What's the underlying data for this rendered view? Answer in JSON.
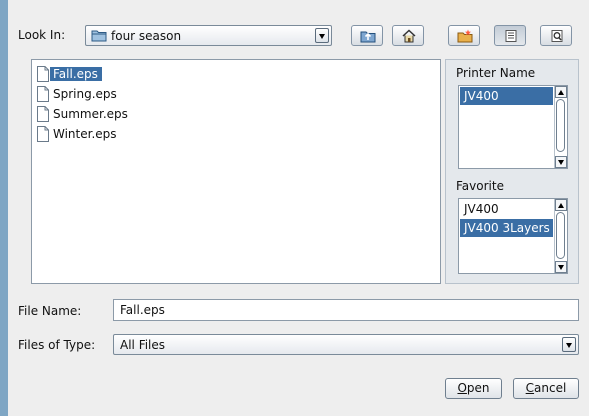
{
  "look_in": {
    "label": "Look In:",
    "value": "four season"
  },
  "toolbar": {
    "up_icon": "folder-up-icon",
    "home_icon": "home-icon",
    "new_folder_icon": "new-folder-icon",
    "list_view_icon": "list-view-icon",
    "details_view_icon": "details-view-icon"
  },
  "files": [
    {
      "name": "Fall.eps"
    },
    {
      "name": "Spring.eps"
    },
    {
      "name": "Summer.eps"
    },
    {
      "name": "Winter.eps"
    }
  ],
  "printer": {
    "label": "Printer Name",
    "items": [
      "JV400"
    ]
  },
  "favorite": {
    "label": "Favorite",
    "items": [
      "JV400",
      "JV400 3Layers"
    ]
  },
  "file_name": {
    "label": "File Name:",
    "value": "Fall.eps"
  },
  "files_of_type": {
    "label": "Files of Type:",
    "value": "All Files"
  },
  "buttons": {
    "open_mnemonic": "O",
    "open_rest": "pen",
    "cancel_mnemonic": "C",
    "cancel_rest": "ancel"
  },
  "colors": {
    "selection": "#3a6ea5",
    "background": "#eeeeee",
    "frame": "#7fa6c4"
  }
}
